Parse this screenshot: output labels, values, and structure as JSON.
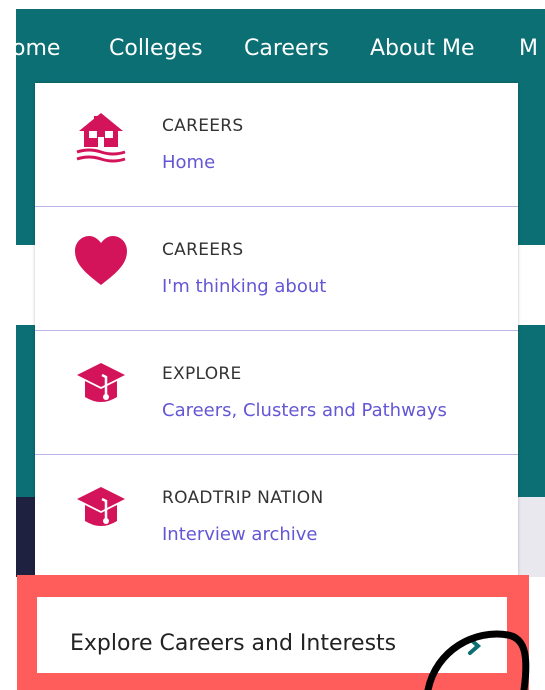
{
  "nav": {
    "items": [
      "ome",
      "Colleges",
      "Careers",
      "About Me",
      "M"
    ]
  },
  "dropdown": {
    "items": [
      {
        "icon": "house-icon",
        "kicker": "CAREERS",
        "link": "Home"
      },
      {
        "icon": "heart-icon",
        "kicker": "CAREERS",
        "link": "I'm thinking about"
      },
      {
        "icon": "graduation-cap-icon",
        "kicker": "EXPLORE",
        "link": "Careers, Clusters and Pathways"
      },
      {
        "icon": "graduation-cap-icon",
        "kicker": "ROADTRIP NATION",
        "link": "Interview archive"
      }
    ]
  },
  "explore": {
    "label": "Explore Careers and Interests",
    "icon": "chevron-right-icon"
  },
  "colors": {
    "nav_bg": "#0b6f74",
    "icon_magenta": "#d4145a",
    "link": "#6357d6",
    "highlight": "#ff5c5c"
  }
}
